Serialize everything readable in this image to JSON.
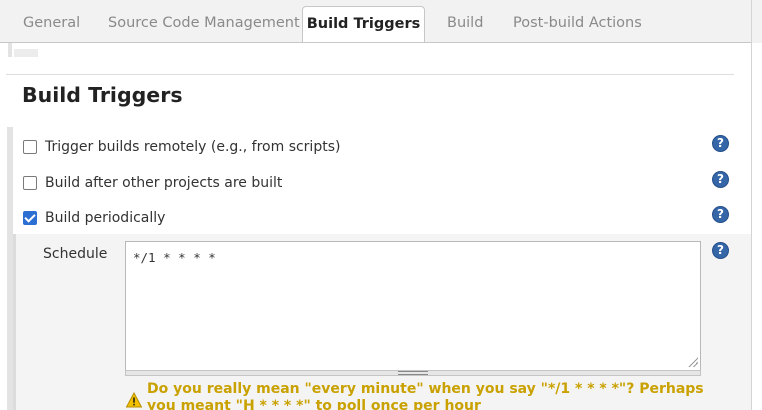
{
  "tabs": [
    {
      "label": "General",
      "active": false
    },
    {
      "label": "Source Code Management",
      "active": false
    },
    {
      "label": "Build Triggers",
      "active": true
    },
    {
      "label": "Build",
      "active": false
    },
    {
      "label": "Post-build Actions",
      "active": false
    }
  ],
  "section": {
    "title": "Build Triggers"
  },
  "triggers": [
    {
      "label": "Trigger builds remotely (e.g., from scripts)",
      "checked": false
    },
    {
      "label": "Build after other projects are built",
      "checked": false
    },
    {
      "label": "Build periodically",
      "checked": true
    }
  ],
  "schedule": {
    "label": "Schedule",
    "value": "*/1 * * * *"
  },
  "warning": {
    "text": "Do you really mean \"every minute\" when you say \"*/1 * * * *\"? Perhaps you meant \"H * * * *\" to poll once per hour"
  },
  "help": {
    "glyph": "?"
  },
  "icons": {
    "help": "help-icon",
    "warning": "warning-icon",
    "check": "checkmark-icon"
  },
  "colors": {
    "accent": "#2c6fd3",
    "help": "#3466a8",
    "warning": "#c9a100"
  }
}
